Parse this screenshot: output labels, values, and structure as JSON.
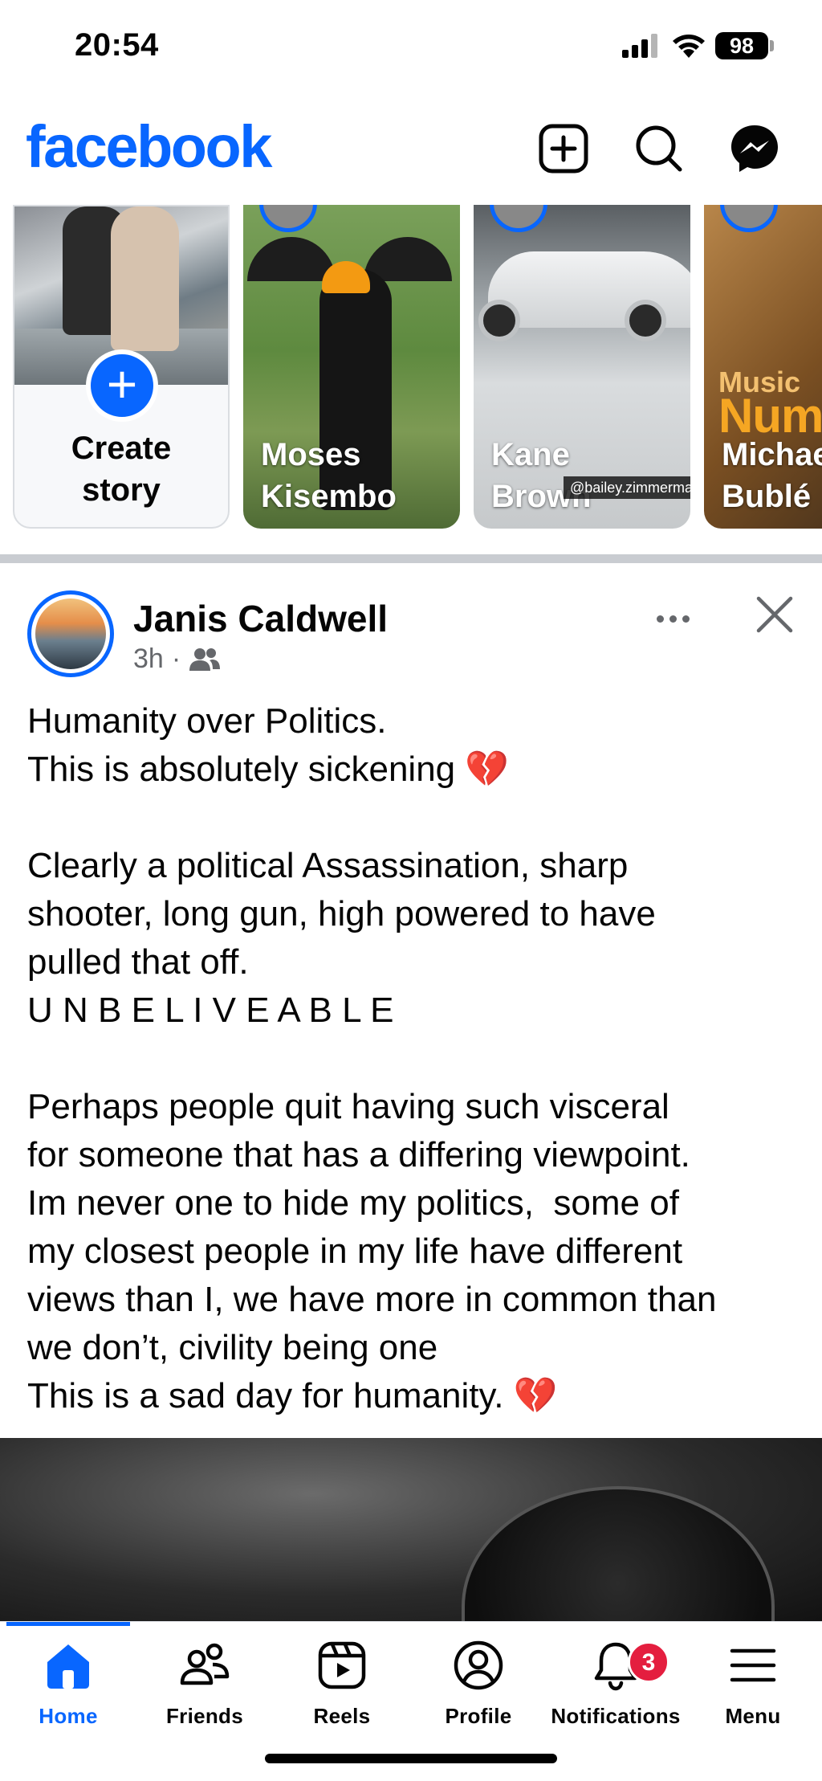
{
  "status_bar": {
    "time": "20:54",
    "battery": "98"
  },
  "header": {
    "logo": "facebook"
  },
  "stories": {
    "create": {
      "label_line1": "Create",
      "label_line2": "story"
    },
    "items": [
      {
        "name_line1": "Moses",
        "name_line2": "Kisembo"
      },
      {
        "name_line1": "Kane",
        "name_line2": "Brown",
        "watermark": "@bailey.zimmerman"
      },
      {
        "name_line1": "Michae",
        "name_line2": "Bublé",
        "cover_text1": "Music",
        "cover_text2": "Num"
      }
    ]
  },
  "post": {
    "author": "Janis Caldwell",
    "time": "3h",
    "lines": [
      "Humanity over Politics.",
      "This is absolutely sickening",
      "",
      "Clearly a political Assassination, sharp",
      "shooter, long gun, high powered to have",
      "pulled that off.",
      "U N B E L I V E A B L E",
      "",
      "Perhaps people quit having such visceral",
      "for someone that has a differing viewpoint.",
      "Im never one to hide my politics,  some of",
      "my closest people in my life have different",
      "views than I, we have more in common than",
      "we don’t, civility being one",
      "This is a sad day for humanity."
    ],
    "emoji": "💔"
  },
  "nav": {
    "items": [
      {
        "label": "Home"
      },
      {
        "label": "Friends"
      },
      {
        "label": "Reels"
      },
      {
        "label": "Profile"
      },
      {
        "label": "Notifications"
      },
      {
        "label": "Menu"
      }
    ],
    "notifications_badge": "3"
  },
  "colors": {
    "brand": "#0866ff",
    "badge": "#e41e3f",
    "heart": "#e02436"
  }
}
